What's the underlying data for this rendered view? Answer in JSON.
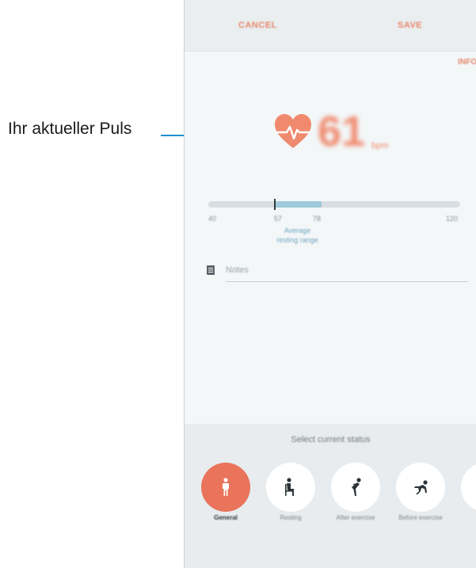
{
  "annotation": {
    "callout_text": "Ihr aktueller Puls"
  },
  "top_bar": {
    "cancel_label": "CANCEL",
    "save_label": "SAVE"
  },
  "info_link": "INFO",
  "pulse": {
    "value": "61",
    "unit": "bpm"
  },
  "resting_range": {
    "ticks": [
      "40",
      "57",
      "78",
      "120"
    ],
    "caption_line1": "Average",
    "caption_line2": "resting range"
  },
  "note": {
    "placeholder": "Notes"
  },
  "status": {
    "title": "Select current status",
    "options": [
      {
        "label": "General",
        "icon": "standing-person-icon",
        "selected": true
      },
      {
        "label": "Resting",
        "icon": "sitting-person-icon",
        "selected": false
      },
      {
        "label": "After exercise",
        "icon": "bending-person-icon",
        "selected": false
      },
      {
        "label": "Before exercise",
        "icon": "crouching-runner-icon",
        "selected": false
      },
      {
        "label": "",
        "icon": "partial-icon",
        "selected": false
      }
    ]
  },
  "colors": {
    "accent": "#e9735b",
    "range_fill": "#9ec9da",
    "callout_line": "#1f8fd0"
  }
}
